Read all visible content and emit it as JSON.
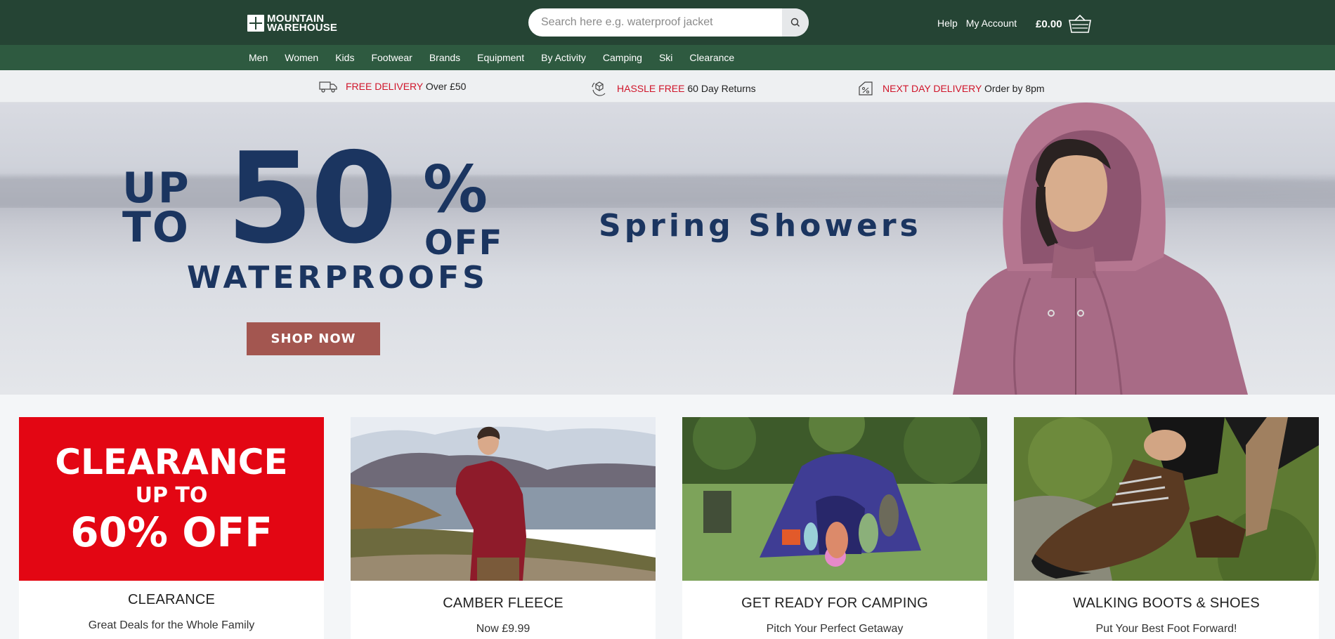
{
  "header": {
    "logo_line1": "MOUNTAIN",
    "logo_line2": "WAREHOUSE",
    "search_placeholder": "Search here e.g. waterproof jacket",
    "help": "Help",
    "account": "My Account",
    "basket_total": "£0.00"
  },
  "nav": [
    "Men",
    "Women",
    "Kids",
    "Footwear",
    "Brands",
    "Equipment",
    "By Activity",
    "Camping",
    "Ski",
    "Clearance"
  ],
  "usp": [
    {
      "highlight": "FREE DELIVERY",
      "text": " Over £50",
      "icon": "delivery-truck-icon"
    },
    {
      "highlight": "HASSLE FREE",
      "text": " 60 Day Returns",
      "icon": "returns-box-icon"
    },
    {
      "highlight": "NEXT DAY DELIVERY",
      "text": " Order by 8pm",
      "icon": "discount-tag-icon"
    }
  ],
  "hero": {
    "up_to": "UP TO",
    "up": "UP",
    "to": "TO",
    "fifty": "50",
    "percent": "%",
    "off": "OFF",
    "waterproofs": "WATERPROOFS",
    "cta": "SHOP NOW",
    "tagline": "Spring Showers"
  },
  "tiles": [
    {
      "title": "CLEARANCE",
      "subtitle": "Great Deals for the Whole Family",
      "panel_l1": "CLEARANCE",
      "panel_l2": "UP TO",
      "panel_l3": "60% OFF"
    },
    {
      "title": "CAMBER FLEECE",
      "subtitle": "Now £9.99"
    },
    {
      "title": "GET READY FOR CAMPING",
      "subtitle": "Pitch Your Perfect Getaway"
    },
    {
      "title": "WALKING BOOTS & SHOES",
      "subtitle": "Put Your Best Foot Forward!"
    }
  ],
  "colors": {
    "header": "#254434",
    "nav": "#2e5a40",
    "accent_red": "#d0152a",
    "hero_text": "#1b3560",
    "cta": "#a35650",
    "clearance_red": "#e30613"
  }
}
